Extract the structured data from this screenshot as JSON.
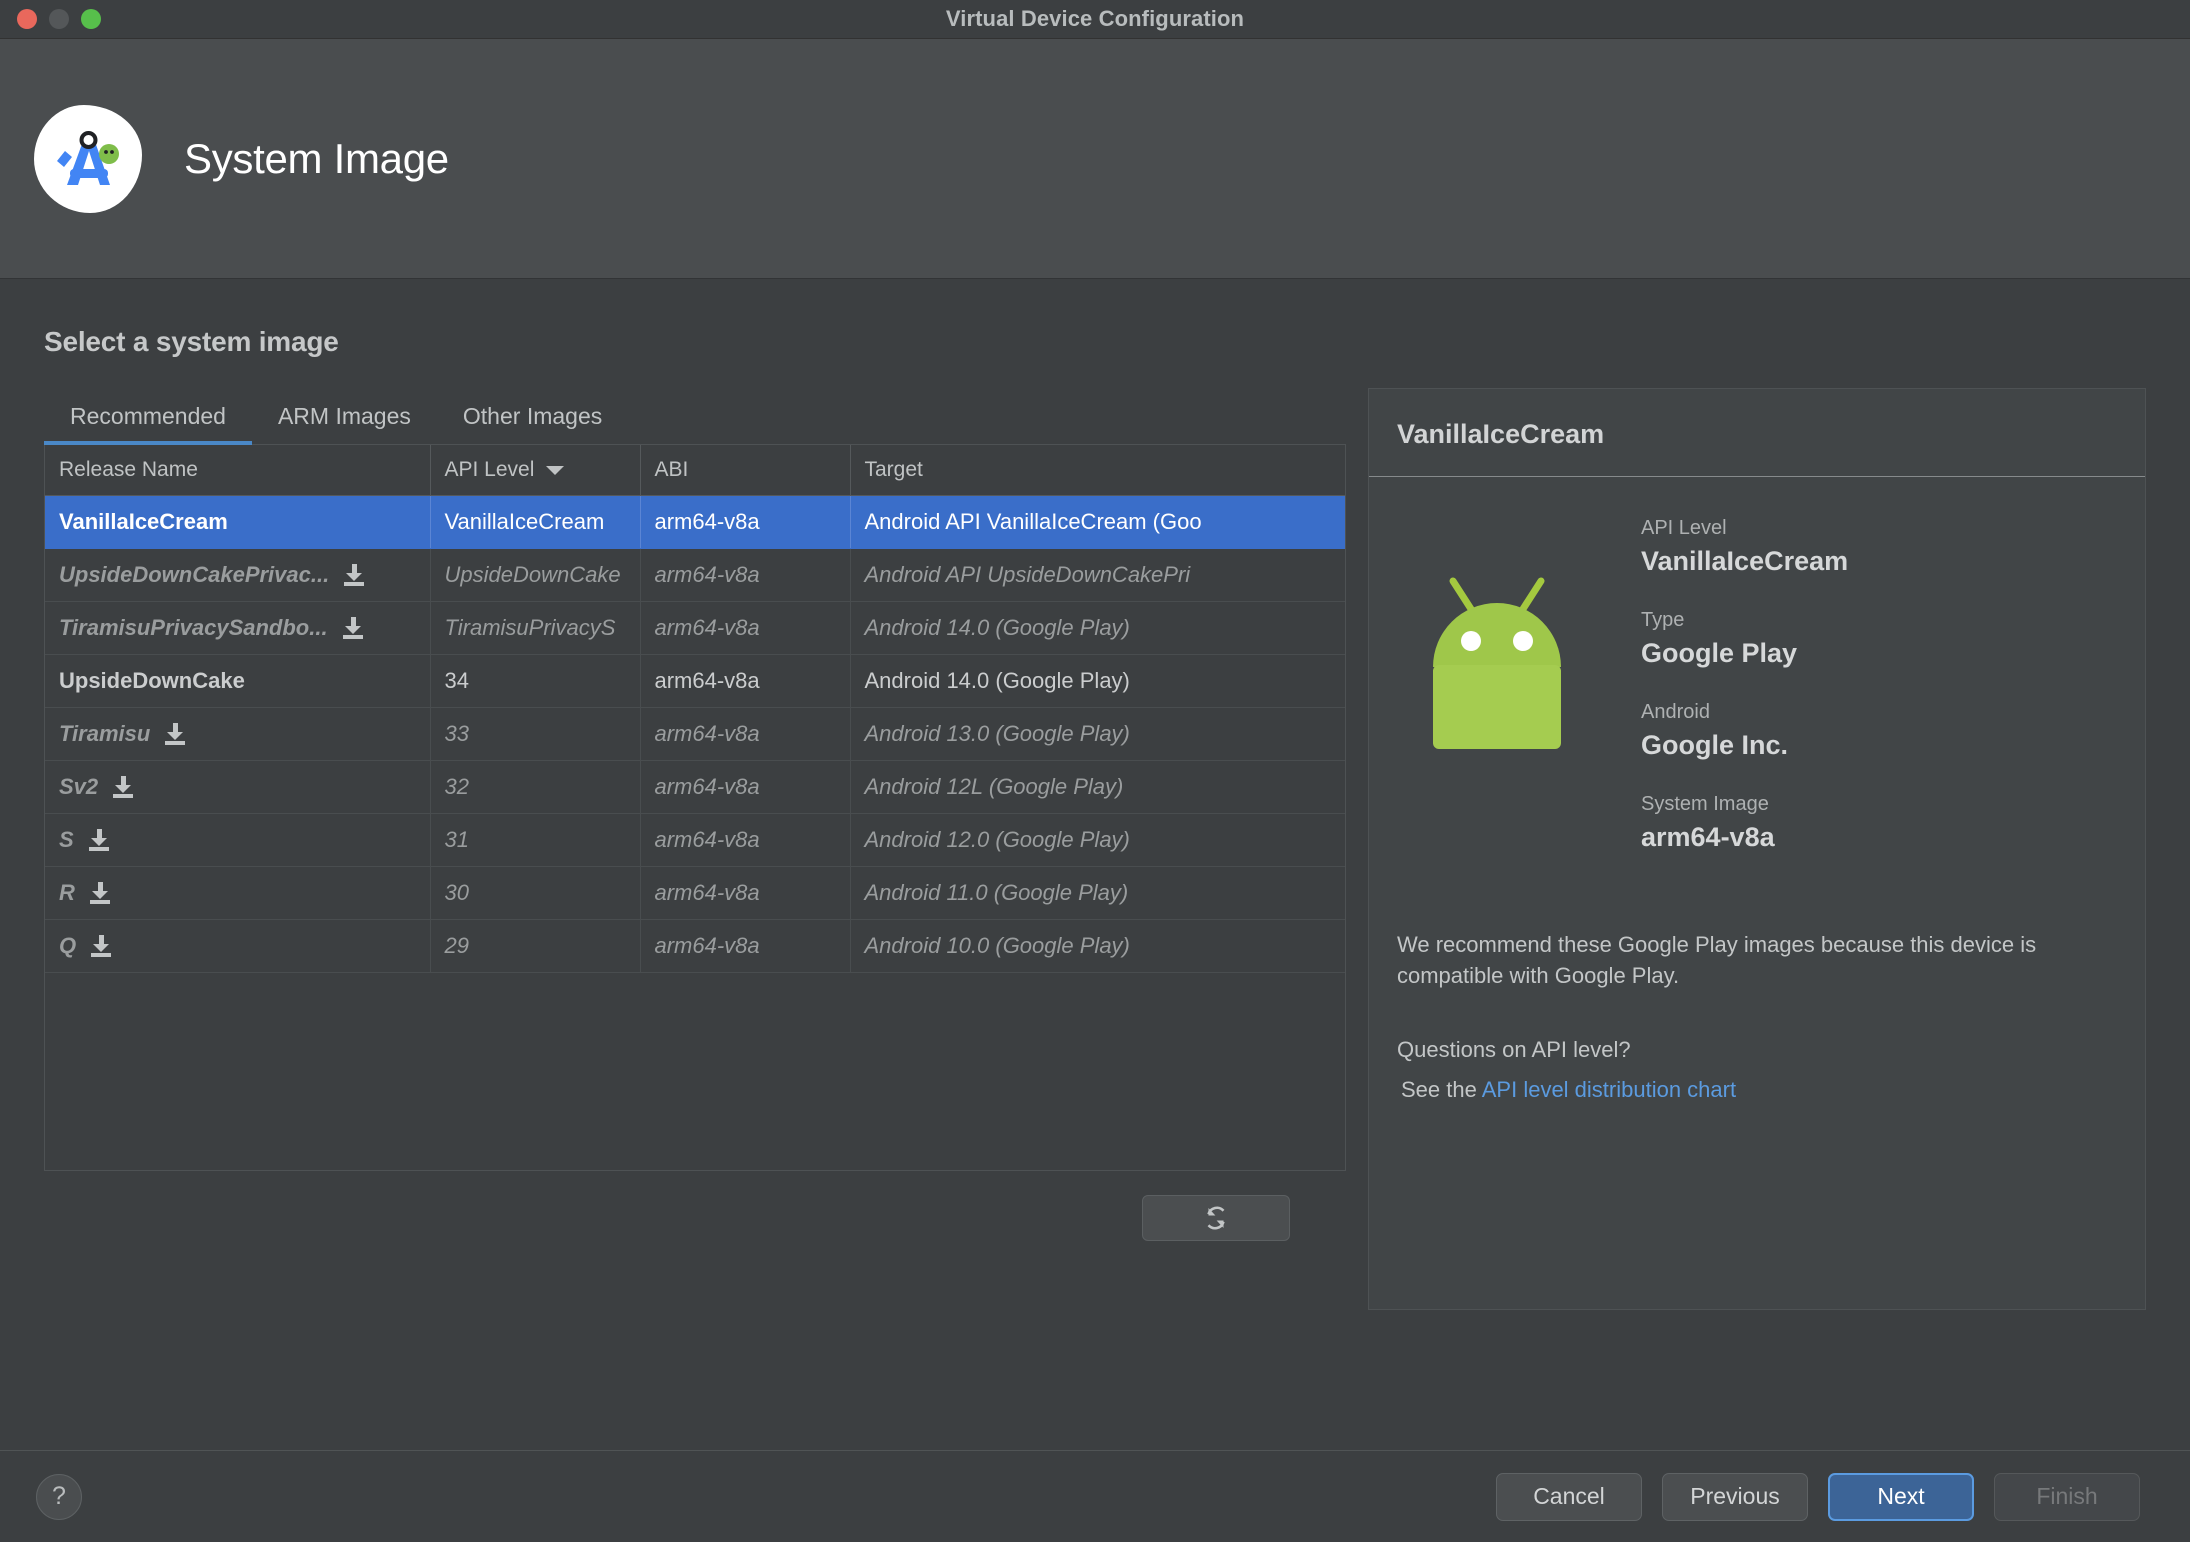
{
  "window": {
    "title": "Virtual Device Configuration",
    "traffic_lights": [
      "close-button",
      "minimize-button",
      "zoom-button"
    ]
  },
  "header": {
    "title": "System Image",
    "logo_icon": "android-studio-logo"
  },
  "main": {
    "section_title": "Select a system image",
    "tabs": [
      {
        "label": "Recommended",
        "active": true
      },
      {
        "label": "ARM Images",
        "active": false
      },
      {
        "label": "Other Images",
        "active": false
      }
    ],
    "table": {
      "columns": [
        {
          "label": "Release Name",
          "sorted": false
        },
        {
          "label": "API Level",
          "sorted": true,
          "sort_icon": "caret-down-icon"
        },
        {
          "label": "ABI",
          "sorted": false
        },
        {
          "label": "Target",
          "sorted": false
        }
      ],
      "rows": [
        {
          "release_name": "VanillaIceCream",
          "api_level": "VanillaIceCream",
          "abi": "arm64-v8a",
          "target": "Android API VanillaIceCream (Goo",
          "selected": true,
          "installed": true,
          "download": false
        },
        {
          "release_name": "UpsideDownCakePrivac...",
          "api_level": "UpsideDownCake",
          "abi": "arm64-v8a",
          "target": "Android API UpsideDownCakePri",
          "selected": false,
          "installed": false,
          "download": true
        },
        {
          "release_name": "TiramisuPrivacySandbo...",
          "api_level": "TiramisuPrivacyS",
          "abi": "arm64-v8a",
          "target": "Android 14.0 (Google Play)",
          "selected": false,
          "installed": false,
          "download": true
        },
        {
          "release_name": "UpsideDownCake",
          "api_level": "34",
          "abi": "arm64-v8a",
          "target": "Android 14.0 (Google Play)",
          "selected": false,
          "installed": true,
          "download": false
        },
        {
          "release_name": "Tiramisu",
          "api_level": "33",
          "abi": "arm64-v8a",
          "target": "Android 13.0 (Google Play)",
          "selected": false,
          "installed": false,
          "download": true
        },
        {
          "release_name": "Sv2",
          "api_level": "32",
          "abi": "arm64-v8a",
          "target": "Android 12L (Google Play)",
          "selected": false,
          "installed": false,
          "download": true
        },
        {
          "release_name": "S",
          "api_level": "31",
          "abi": "arm64-v8a",
          "target": "Android 12.0 (Google Play)",
          "selected": false,
          "installed": false,
          "download": true
        },
        {
          "release_name": "R",
          "api_level": "30",
          "abi": "arm64-v8a",
          "target": "Android 11.0 (Google Play)",
          "selected": false,
          "installed": false,
          "download": true
        },
        {
          "release_name": "Q",
          "api_level": "29",
          "abi": "arm64-v8a",
          "target": "Android 10.0 (Google Play)",
          "selected": false,
          "installed": false,
          "download": true
        }
      ]
    },
    "refresh_icon": "refresh-icon"
  },
  "detail": {
    "header_title": "VanillaIceCream",
    "robot_icon": "android-robot-icon",
    "fields": [
      {
        "label": "API Level",
        "value": "VanillaIceCream"
      },
      {
        "label": "Type",
        "value": "Google Play"
      },
      {
        "label": "Android",
        "value": "Google Inc."
      },
      {
        "label": "System Image",
        "value": "arm64-v8a"
      }
    ],
    "recommendation": "We recommend these Google Play images because this device is compatible with Google Play.",
    "question": "Questions on API level?",
    "see_the_prefix": "See the ",
    "link_label": "API level distribution chart"
  },
  "footer": {
    "help_label": "?",
    "buttons": [
      {
        "label": "Cancel",
        "style": "normal"
      },
      {
        "label": "Previous",
        "style": "normal"
      },
      {
        "label": "Next",
        "style": "primary"
      },
      {
        "label": "Finish",
        "style": "disabled"
      }
    ]
  },
  "colors": {
    "accent_blue": "#3a6ec9",
    "tab_underline": "#4a88c7",
    "link_blue": "#5b9be0",
    "android_green": "#a4c639",
    "window_bg": "#3c3f41",
    "header_bg": "#4a4d4f"
  }
}
